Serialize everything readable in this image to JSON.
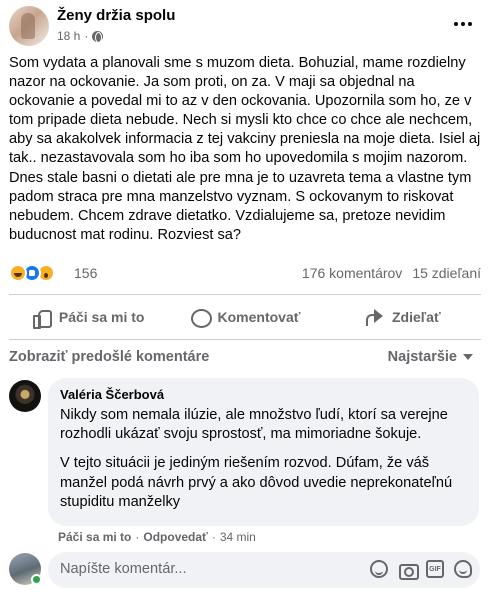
{
  "post": {
    "group_name": "Ženy držia spolu",
    "time": "18 h",
    "separator": "·",
    "text": "Som vydata a planovali sme s muzom dieta. Bohuzial, mame rozdielny nazor na ockovanie. Ja som proti, on za. V maji sa objednal na ockovanie a povedal mi to az v den ockovania. Upozornila som ho, ze v tom pripade dieta nebude. Nech si mysli kto chce co chce ale nechcem, aby sa akakolvek informacia z tej vakciny preniesla na moje dieta. Isiel aj tak.. nezastavovala som ho iba som ho upovedomila s mojim nazorom. Dnes stale basni o dietati ale pre mna je to uzavreta tema a vlastne tym padom straca pre mna manzelstvo vyznam. S ockovanym to riskovat nebudem. Chcem zdrave dietatko. Vzdialujeme sa, pretoze nevidim buducnost mat rodinu. Rozviest sa?"
  },
  "stats": {
    "reactions": [
      "haha-icon",
      "like-icon",
      "wow-icon"
    ],
    "reaction_count": "156",
    "comments": "176 komentárov",
    "shares": "15 zdieľaní"
  },
  "actions": {
    "like": "Páči sa mi to",
    "comment": "Komentovať",
    "share": "Zdieľať"
  },
  "comments": {
    "prev_label": "Zobraziť predošlé komentáre",
    "sort_label": "Najstaršie",
    "items": [
      {
        "author": "Valéria Ščerbová",
        "p1": "Nikdy som nemala ilúzie, ale množstvo ľudí, ktorí sa verejne rozhodli ukázať svoju sprostosť, ma mimoriadne šokuje.",
        "p2": "V tejto situácii je jediným riešením rozvod. Dúfam, že váš manžel podá návrh prvý a ako dôvod uvedie neprekonateľnú stupiditu manželky",
        "like": "Páči sa mi to",
        "reply": "Odpovedať",
        "time": "34 min",
        "dot": "·"
      }
    ]
  },
  "composer": {
    "placeholder": "Napíšte komentár...",
    "gif_label": "GIF"
  },
  "colors": {
    "secondary_text": "#65676b",
    "bubble_bg": "#f0f2f5",
    "like_blue": "#1877f2",
    "online_green": "#31a24c"
  }
}
